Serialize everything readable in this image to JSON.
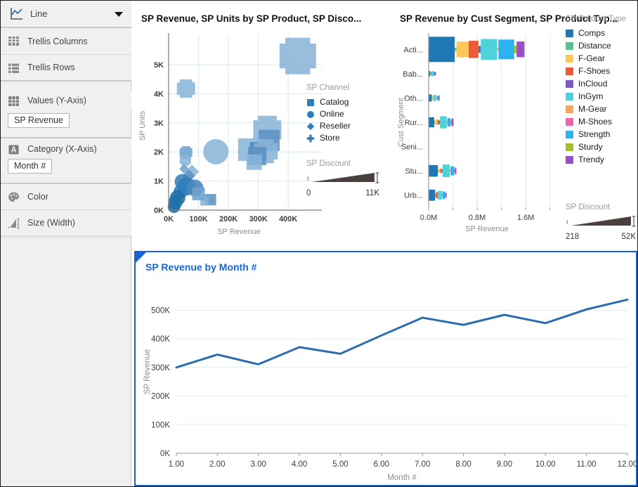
{
  "sidebar": {
    "chart_type": {
      "label": "Line",
      "icon": "line-chart-icon",
      "caret": "chevron-down-icon"
    },
    "shelves": [
      {
        "label": "Trellis Columns",
        "icon": "trellis-columns-icon"
      },
      {
        "label": "Trellis Rows",
        "icon": "trellis-rows-icon"
      },
      {
        "label": "Values (Y-Axis)",
        "icon": "values-grid-icon",
        "chip": "SP Revenue"
      },
      {
        "label": "Category (X-Axis)",
        "icon": "category-a-icon",
        "chip": "Month #"
      },
      {
        "label": "Color",
        "icon": "palette-icon"
      },
      {
        "label": "Size (Width)",
        "icon": "size-width-icon"
      }
    ]
  },
  "scatter_panel": {
    "title": "SP Revenue, SP Units by SP Product, SP Disco...",
    "legend_channel_title": "SP Channel",
    "channels": [
      {
        "label": "Catalog",
        "shape": "square",
        "color": "#2e7ebb"
      },
      {
        "label": "Online",
        "shape": "circle",
        "color": "#2e7ebb"
      },
      {
        "label": "Reseller",
        "shape": "diamond",
        "color": "#2e7ebb"
      },
      {
        "label": "Store",
        "shape": "cross",
        "color": "#2e7ebb"
      }
    ],
    "discount_title": "SP Discount",
    "discount_min": "0",
    "discount_max": "11K"
  },
  "bar_panel": {
    "title": "SP Revenue by Cust Segment, SP Product Typ...",
    "legend_product_title": "SP Product Type",
    "products": [
      {
        "label": "Comps",
        "color": "#1f77b4"
      },
      {
        "label": "Distance",
        "color": "#5ac08c"
      },
      {
        "label": "F-Gear",
        "color": "#fdc martin"
      },
      {
        "label": "F-Shoes",
        "color": "#ed5a36"
      },
      {
        "label": "InCloud",
        "color": "#7c5cc4"
      },
      {
        "label": "InGym",
        "color": "#4ed3d8"
      },
      {
        "label": "M-Gear",
        "color": "#f6a council"
      },
      {
        "label": "M-Shoes",
        "color": "#ea67ad"
      },
      {
        "label": "Strength",
        "color": "#2bb3f0"
      },
      {
        "label": "Sturdy",
        "color": "#a2bf2e"
      },
      {
        "label": "Trendy",
        "color": "#9b4fc4"
      }
    ],
    "discount_title": "SP Discount",
    "discount_min": "218",
    "discount_max": "52K"
  },
  "bottom_panel": {
    "title": "SP Revenue by Month #"
  },
  "chart_data": [
    {
      "type": "scatter",
      "title": "SP Revenue, SP Units by SP Product, SP Disco...",
      "xlabel": "SP Revenue",
      "ylabel": "SP Units",
      "xticks": [
        "0K",
        "100K",
        "200K",
        "300K",
        "400K"
      ],
      "xtickvals": [
        0,
        100000,
        200000,
        300000,
        400000
      ],
      "yticks": [
        "0K",
        "1K",
        "2K",
        "3K",
        "4K",
        "5K"
      ],
      "ytickvals": [
        0,
        1000,
        2000,
        3000,
        4000,
        5000
      ],
      "xlim": [
        0,
        470000
      ],
      "ylim": [
        0,
        5800
      ],
      "grid": true,
      "legend_position": "right",
      "size_encoding": "SP Discount",
      "size_legend": {
        "min": 0,
        "max": 11000,
        "min_label": "0",
        "max_label": "11K"
      },
      "shape_encoding": "SP Channel",
      "points": [
        {
          "x": 432000,
          "y": 5300,
          "size": 52,
          "shape": "cross",
          "color": "#8ab4d8"
        },
        {
          "x": 58000,
          "y": 4180,
          "size": 26,
          "shape": "cross",
          "color": "#8ab4d8"
        },
        {
          "x": 330000,
          "y": 2760,
          "size": 40,
          "shape": "cross",
          "color": "#8ab4d8"
        },
        {
          "x": 336000,
          "y": 2400,
          "size": 30,
          "shape": "square",
          "color": "#5b93c4"
        },
        {
          "x": 270000,
          "y": 2080,
          "size": 32,
          "shape": "square",
          "color": "#8ab4d8"
        },
        {
          "x": 300000,
          "y": 2050,
          "size": 24,
          "shape": "square",
          "color": "#4a87bd"
        },
        {
          "x": 325000,
          "y": 2020,
          "size": 34,
          "shape": "cross",
          "color": "#8ab4d8"
        },
        {
          "x": 158000,
          "y": 2010,
          "size": 36,
          "shape": "circle",
          "color": "#8ab4d8"
        },
        {
          "x": 296000,
          "y": 1860,
          "size": 26,
          "shape": "square",
          "color": "#5b93c4"
        },
        {
          "x": 286000,
          "y": 1650,
          "size": 22,
          "shape": "square",
          "color": "#8ab4d8"
        },
        {
          "x": 58000,
          "y": 1980,
          "size": 18,
          "shape": "cross",
          "color": "#6ea3cd"
        },
        {
          "x": 56000,
          "y": 1720,
          "size": 16,
          "shape": "cross",
          "color": "#8ab4d8"
        },
        {
          "x": 52000,
          "y": 1420,
          "size": 14,
          "shape": "diamond",
          "color": "#6ea3cd"
        },
        {
          "x": 78000,
          "y": 1320,
          "size": 20,
          "shape": "diamond",
          "color": "#8ab4d8"
        },
        {
          "x": 68000,
          "y": 1180,
          "size": 18,
          "shape": "diamond",
          "color": "#5b93c4"
        },
        {
          "x": 46000,
          "y": 980,
          "size": 22,
          "shape": "circle",
          "color": "#3a7fb5"
        },
        {
          "x": 60000,
          "y": 820,
          "size": 26,
          "shape": "circle",
          "color": "#2e7ebb"
        },
        {
          "x": 88000,
          "y": 760,
          "size": 24,
          "shape": "circle",
          "color": "#4a87bd"
        },
        {
          "x": 40000,
          "y": 640,
          "size": 20,
          "shape": "circle",
          "color": "#2e7ebb"
        },
        {
          "x": 30000,
          "y": 420,
          "size": 22,
          "shape": "circle",
          "color": "#1f6fa8"
        },
        {
          "x": 22000,
          "y": 260,
          "size": 20,
          "shape": "circle",
          "color": "#1f6fa8"
        },
        {
          "x": 140000,
          "y": 360,
          "size": 16,
          "shape": "square",
          "color": "#5b93c4"
        },
        {
          "x": 120000,
          "y": 300,
          "size": 12,
          "shape": "square",
          "color": "#8ab4d8"
        },
        {
          "x": 100000,
          "y": 560,
          "size": 18,
          "shape": "square",
          "color": "#6ea3cd"
        },
        {
          "x": 18000,
          "y": 120,
          "size": 18,
          "shape": "circle",
          "color": "#1f6fa8"
        }
      ]
    },
    {
      "type": "bar",
      "subtype": "marimekko",
      "title": "SP Revenue by Cust Segment, SP Product Typ...",
      "xlabel": "SP Revenue",
      "ylabel": "Cust Segment",
      "xticks": [
        "0.0M",
        "0.8M",
        "1.6M"
      ],
      "xtickvals": [
        0,
        800000,
        1600000
      ],
      "xlim": [
        0,
        2200000
      ],
      "grid": true,
      "legend_position": "right",
      "categories": [
        "Acti...",
        "Bab...",
        "Oth...",
        "Rur...",
        "Seni...",
        "Stu...",
        "Urb..."
      ],
      "series_order": [
        "Comps",
        "Distance",
        "F-Gear",
        "F-Shoes",
        "InCloud",
        "InGym",
        "M-Gear",
        "M-Shoes",
        "Strength",
        "Sturdy",
        "Trendy"
      ],
      "size_encoding": "SP Discount",
      "size_legend": {
        "min": 218,
        "max": 52000,
        "min_label": "218",
        "max_label": "52K"
      },
      "rows": [
        {
          "category": "Acti...",
          "segments": [
            {
              "product": "Comps",
              "value": 430000,
              "thickness": 1.0
            },
            {
              "product": "Distance",
              "value": 30000,
              "thickness": 0.14
            },
            {
              "product": "F-Gear",
              "value": 200000,
              "thickness": 0.62
            },
            {
              "product": "F-Shoes",
              "value": 160000,
              "thickness": 0.68
            },
            {
              "product": "InCloud",
              "value": 40000,
              "thickness": 0.28
            },
            {
              "product": "InGym",
              "value": 270000,
              "thickness": 0.82
            },
            {
              "product": "M-Gear",
              "value": 20000,
              "thickness": 0.1
            },
            {
              "product": "Strength",
              "value": 260000,
              "thickness": 0.78
            },
            {
              "product": "Sturdy",
              "value": 40000,
              "thickness": 0.3
            },
            {
              "product": "Trendy",
              "value": 130000,
              "thickness": 0.62
            }
          ]
        },
        {
          "category": "Bab...",
          "segments": [
            {
              "product": "Comps",
              "value": 26000,
              "thickness": 0.22
            },
            {
              "product": "Distance",
              "value": 8000,
              "thickness": 0.09
            },
            {
              "product": "F-Shoes",
              "value": 10000,
              "thickness": 0.11
            },
            {
              "product": "InGym",
              "value": 34000,
              "thickness": 0.2
            },
            {
              "product": "Strength",
              "value": 20000,
              "thickness": 0.17
            },
            {
              "product": "Trendy",
              "value": 16000,
              "thickness": 0.13
            }
          ]
        },
        {
          "category": "Oth...",
          "segments": [
            {
              "product": "Comps",
              "value": 52000,
              "thickness": 0.28
            },
            {
              "product": "F-Gear",
              "value": 24000,
              "thickness": 0.14
            },
            {
              "product": "InGym",
              "value": 48000,
              "thickness": 0.25
            },
            {
              "product": "M-Gear",
              "value": 12000,
              "thickness": 0.1
            },
            {
              "product": "Strength",
              "value": 22000,
              "thickness": 0.17
            },
            {
              "product": "Trendy",
              "value": 20000,
              "thickness": 0.2
            }
          ]
        },
        {
          "category": "Rur...",
          "segments": [
            {
              "product": "Comps",
              "value": 92000,
              "thickness": 0.4
            },
            {
              "product": "Distance",
              "value": 14000,
              "thickness": 0.12
            },
            {
              "product": "F-Gear",
              "value": 40000,
              "thickness": 0.22
            },
            {
              "product": "F-Shoes",
              "value": 26000,
              "thickness": 0.2
            },
            {
              "product": "InCloud",
              "value": 16000,
              "thickness": 0.14
            },
            {
              "product": "InGym",
              "value": 110000,
              "thickness": 0.48
            },
            {
              "product": "M-Gear",
              "value": 10000,
              "thickness": 0.08
            },
            {
              "product": "Strength",
              "value": 54000,
              "thickness": 0.33
            },
            {
              "product": "Sturdy",
              "value": 14000,
              "thickness": 0.14
            },
            {
              "product": "Trendy",
              "value": 34000,
              "thickness": 0.3
            }
          ]
        },
        {
          "category": "Seni...",
          "segments": []
        },
        {
          "category": "Stu...",
          "segments": [
            {
              "product": "Comps",
              "value": 150000,
              "thickness": 0.46
            },
            {
              "product": "Distance",
              "value": 12000,
              "thickness": 0.11
            },
            {
              "product": "F-Gear",
              "value": 30000,
              "thickness": 0.17
            },
            {
              "product": "F-Shoes",
              "value": 24000,
              "thickness": 0.18
            },
            {
              "product": "InCloud",
              "value": 14000,
              "thickness": 0.13
            },
            {
              "product": "InGym",
              "value": 120000,
              "thickness": 0.5
            },
            {
              "product": "M-Gear",
              "value": 12000,
              "thickness": 0.1
            },
            {
              "product": "Strength",
              "value": 60000,
              "thickness": 0.36
            },
            {
              "product": "M-Shoes",
              "value": 12000,
              "thickness": 0.12
            },
            {
              "product": "Trendy",
              "value": 22000,
              "thickness": 0.26
            }
          ]
        },
        {
          "category": "Urb...",
          "segments": [
            {
              "product": "Comps",
              "value": 108000,
              "thickness": 0.44
            },
            {
              "product": "Distance",
              "value": 12000,
              "thickness": 0.12
            },
            {
              "product": "F-Shoes",
              "value": 30000,
              "thickness": 0.24
            },
            {
              "product": "InGym",
              "value": 70000,
              "thickness": 0.34
            },
            {
              "product": "M-Gear",
              "value": 8000,
              "thickness": 0.08
            },
            {
              "product": "Strength",
              "value": 46000,
              "thickness": 0.3
            },
            {
              "product": "Trendy",
              "value": 20000,
              "thickness": 0.18
            }
          ]
        }
      ]
    },
    {
      "type": "line",
      "title": "SP Revenue by Month #",
      "xlabel": "Month #",
      "ylabel": "SP Revenue",
      "categories": [
        "1.00",
        "2.00",
        "3.00",
        "4.00",
        "5.00",
        "6.00",
        "7.00",
        "8.00",
        "9.00",
        "10.00",
        "11.00",
        "12.00"
      ],
      "values": [
        300000,
        345000,
        311000,
        371000,
        348000,
        412000,
        474000,
        449000,
        484000,
        455000,
        503000,
        537000
      ],
      "yticks": [
        "0K",
        "100K",
        "200K",
        "300K",
        "400K",
        "500K"
      ],
      "ytickvals": [
        0,
        100000,
        200000,
        300000,
        400000,
        500000
      ],
      "ylim": [
        0,
        570000
      ],
      "grid": true,
      "line_color": "#2b6cb0",
      "line_width": 3
    }
  ]
}
